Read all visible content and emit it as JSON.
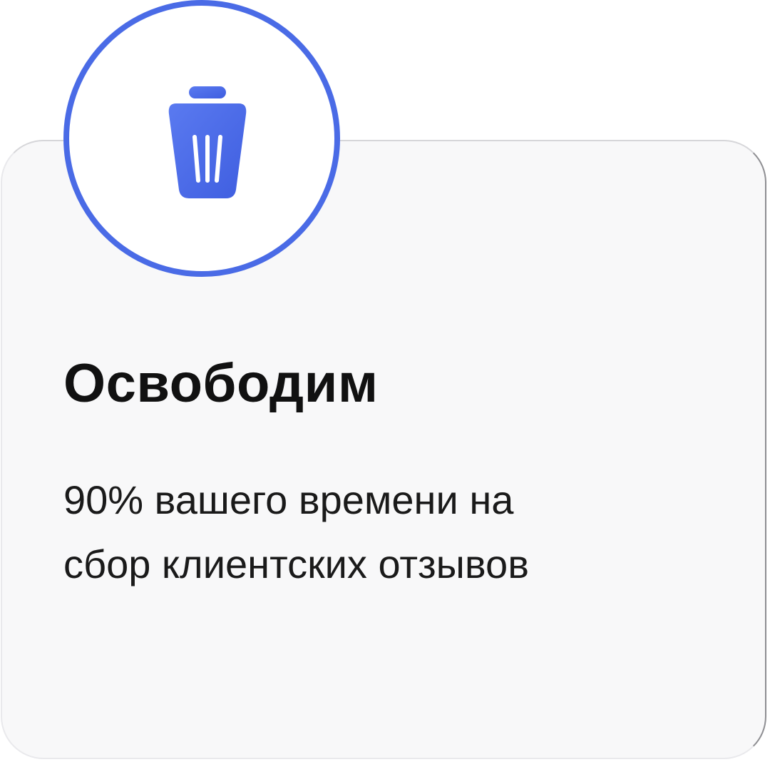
{
  "card": {
    "title": "Освободим",
    "description_lines": [
      "90% вашего времени на",
      "сбор клиентских отзывов"
    ]
  },
  "icon": {
    "name": "trash-icon",
    "accent_color": "#4a6be6"
  }
}
